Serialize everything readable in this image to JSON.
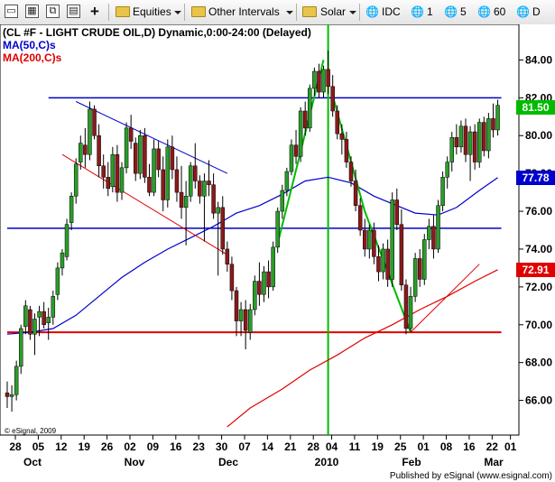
{
  "toolbar": {
    "items": [
      {
        "label": "Equities",
        "icon": "folder-icon",
        "dropdown": true
      },
      {
        "label": "Other Intervals",
        "icon": "folder-icon",
        "dropdown": true
      },
      {
        "label": "Solar",
        "icon": "folder-icon",
        "dropdown": true
      },
      {
        "label": "IDC",
        "icon": "globe-icon"
      },
      {
        "label": "1",
        "icon": "globe-icon"
      },
      {
        "label": "5",
        "icon": "globe-icon"
      },
      {
        "label": "60",
        "icon": "globe-icon"
      },
      {
        "label": "D",
        "icon": "globe-icon"
      }
    ]
  },
  "chart_data": {
    "type": "candlestick",
    "title": "(CL #F - LIGHT CRUDE OIL,D) Dynamic,0:00-24:00 (Delayed)",
    "indicators": [
      {
        "name": "MA(50,C)s",
        "color": "#0000cc",
        "last_value": "77.78"
      },
      {
        "name": "MA(200,C)s",
        "color": "#e00000",
        "last_value": "72.91"
      }
    ],
    "last_price": "81.50",
    "last_price_color": "#00bb00",
    "copyright": "© eSignal, 2009",
    "footer": "Published by eSignal (www.esignal.com)",
    "ylim": [
      64.5,
      85.5
    ],
    "y_ticks": [
      "84.00",
      "82.00",
      "80.00",
      "78.00",
      "76.00",
      "74.00",
      "72.00",
      "70.00",
      "68.00",
      "66.00"
    ],
    "x_day_labels": [
      "28",
      "05",
      "12",
      "19",
      "26",
      "02",
      "09",
      "16",
      "23",
      "30",
      "07",
      "14",
      "21",
      "28",
      "04",
      "11",
      "19",
      "25",
      "01",
      "08",
      "16",
      "22",
      "01"
    ],
    "x_month_labels": [
      "Oct",
      "Nov",
      "Dec",
      "2010",
      "Feb",
      "Mar"
    ],
    "candles": [
      [
        66.4,
        67.0,
        65.6,
        66.2
      ],
      [
        66.2,
        66.8,
        65.4,
        66.3
      ],
      [
        66.3,
        68.1,
        66.0,
        67.8
      ],
      [
        67.8,
        70.0,
        67.4,
        69.8
      ],
      [
        69.9,
        71.3,
        69.5,
        71.0
      ],
      [
        70.8,
        71.0,
        69.2,
        69.5
      ],
      [
        69.5,
        70.6,
        68.4,
        70.3
      ],
      [
        70.4,
        71.0,
        69.4,
        70.7
      ],
      [
        70.7,
        71.2,
        69.8,
        70.0
      ],
      [
        70.1,
        70.9,
        69.2,
        70.4
      ],
      [
        70.4,
        71.8,
        70.0,
        71.5
      ],
      [
        71.6,
        73.3,
        71.3,
        73.0
      ],
      [
        73.0,
        74.0,
        72.6,
        73.8
      ],
      [
        73.6,
        75.6,
        73.4,
        75.3
      ],
      [
        75.4,
        77.0,
        75.0,
        76.8
      ],
      [
        76.8,
        78.8,
        76.4,
        78.5
      ],
      [
        78.6,
        80.0,
        78.2,
        79.6
      ],
      [
        79.5,
        80.4,
        78.3,
        79.0
      ],
      [
        79.0,
        81.8,
        78.7,
        81.4
      ],
      [
        81.4,
        81.6,
        79.8,
        80.0
      ],
      [
        80.0,
        80.6,
        77.8,
        78.4
      ],
      [
        78.4,
        79.0,
        77.2,
        77.8
      ],
      [
        77.8,
        78.6,
        76.8,
        77.2
      ],
      [
        77.3,
        79.4,
        77.0,
        79.0
      ],
      [
        79.0,
        79.5,
        76.5,
        77.0
      ],
      [
        77.0,
        78.6,
        76.6,
        78.3
      ],
      [
        78.3,
        80.7,
        78.0,
        80.4
      ],
      [
        80.4,
        81.1,
        79.3,
        79.7
      ],
      [
        79.6,
        79.9,
        77.6,
        78.0
      ],
      [
        78.0,
        80.3,
        77.7,
        80.0
      ],
      [
        80.0,
        80.4,
        77.5,
        77.8
      ],
      [
        77.8,
        78.5,
        76.8,
        77.0
      ],
      [
        77.0,
        79.8,
        76.8,
        79.3
      ],
      [
        79.3,
        79.7,
        77.8,
        78.2
      ],
      [
        78.2,
        78.9,
        76.0,
        76.6
      ],
      [
        76.6,
        79.8,
        76.2,
        79.4
      ],
      [
        79.4,
        80.0,
        77.7,
        78.2
      ],
      [
        78.2,
        78.9,
        76.5,
        77.0
      ],
      [
        77.0,
        78.4,
        75.6,
        76.2
      ],
      [
        76.2,
        77.6,
        74.2,
        76.8
      ],
      [
        76.8,
        78.6,
        76.5,
        78.4
      ],
      [
        78.4,
        79.6,
        77.2,
        77.6
      ],
      [
        77.6,
        77.9,
        76.4,
        76.8
      ],
      [
        76.8,
        78.0,
        74.4,
        77.6
      ],
      [
        77.6,
        78.7,
        76.8,
        77.4
      ],
      [
        77.4,
        78.0,
        75.6,
        75.9
      ],
      [
        75.9,
        76.5,
        72.6,
        76.2
      ],
      [
        76.2,
        76.8,
        73.7,
        74.0
      ],
      [
        74.0,
        74.4,
        72.8,
        73.2
      ],
      [
        73.2,
        73.6,
        71.3,
        71.8
      ],
      [
        71.8,
        72.0,
        69.4,
        70.2
      ],
      [
        70.2,
        71.2,
        69.4,
        70.8
      ],
      [
        70.8,
        71.3,
        68.7,
        69.7
      ],
      [
        69.6,
        71.1,
        69.2,
        70.8
      ],
      [
        70.8,
        72.6,
        70.5,
        72.3
      ],
      [
        72.3,
        73.3,
        71.0,
        71.6
      ],
      [
        71.6,
        73.1,
        71.2,
        72.8
      ],
      [
        72.8,
        73.4,
        71.4,
        72.0
      ],
      [
        72.0,
        74.4,
        71.8,
        74.1
      ],
      [
        74.1,
        76.2,
        73.8,
        76.0
      ],
      [
        76.0,
        77.4,
        75.6,
        77.1
      ],
      [
        77.1,
        78.3,
        76.8,
        78.1
      ],
      [
        78.1,
        79.8,
        77.9,
        79.5
      ],
      [
        79.5,
        80.3,
        78.5,
        78.9
      ],
      [
        78.9,
        81.5,
        78.6,
        81.3
      ],
      [
        81.3,
        81.8,
        80.0,
        80.4
      ],
      [
        80.4,
        82.7,
        80.2,
        82.5
      ],
      [
        82.5,
        83.6,
        82.1,
        83.4
      ],
      [
        83.4,
        83.8,
        82.0,
        82.3
      ],
      [
        82.3,
        83.7,
        82.0,
        83.5
      ],
      [
        83.5,
        84.5,
        82.2,
        82.6
      ],
      [
        82.6,
        83.2,
        81.0,
        81.3
      ],
      [
        81.3,
        81.6,
        79.8,
        80.1
      ],
      [
        80.1,
        80.6,
        79.0,
        79.8
      ],
      [
        79.8,
        80.2,
        78.3,
        78.6
      ],
      [
        78.6,
        78.9,
        77.3,
        77.6
      ],
      [
        77.6,
        78.2,
        76.0,
        76.3
      ],
      [
        76.3,
        76.7,
        74.7,
        75.0
      ],
      [
        75.0,
        75.6,
        73.6,
        74.0
      ],
      [
        74.0,
        75.3,
        73.5,
        75.0
      ],
      [
        75.0,
        75.4,
        73.2,
        73.6
      ],
      [
        73.6,
        74.2,
        72.3,
        72.8
      ],
      [
        72.8,
        74.3,
        72.4,
        74.0
      ],
      [
        74.0,
        74.5,
        72.0,
        72.4
      ],
      [
        72.4,
        77.0,
        72.0,
        76.6
      ],
      [
        76.6,
        77.2,
        75.0,
        75.3
      ],
      [
        75.3,
        76.1,
        71.8,
        72.1
      ],
      [
        72.1,
        72.4,
        69.5,
        69.8
      ],
      [
        69.8,
        72.0,
        69.6,
        71.5
      ],
      [
        71.5,
        73.8,
        71.2,
        73.5
      ],
      [
        73.5,
        74.0,
        72.0,
        72.4
      ],
      [
        72.4,
        74.8,
        72.1,
        74.5
      ],
      [
        74.5,
        75.6,
        74.0,
        75.2
      ],
      [
        75.2,
        75.8,
        73.5,
        74.0
      ],
      [
        74.0,
        76.6,
        73.8,
        76.3
      ],
      [
        76.3,
        78.1,
        76.0,
        77.8
      ],
      [
        77.8,
        78.9,
        77.2,
        78.6
      ],
      [
        78.6,
        80.2,
        78.1,
        79.9
      ],
      [
        79.9,
        80.6,
        79.0,
        79.4
      ],
      [
        79.4,
        80.8,
        79.1,
        80.5
      ],
      [
        80.5,
        80.9,
        78.6,
        79.0
      ],
      [
        79.0,
        80.5,
        77.6,
        80.2
      ],
      [
        80.2,
        80.6,
        78.2,
        78.6
      ],
      [
        78.6,
        80.9,
        78.3,
        80.7
      ],
      [
        80.7,
        81.0,
        78.9,
        79.2
      ],
      [
        79.2,
        81.2,
        78.8,
        80.9
      ],
      [
        80.9,
        81.7,
        79.9,
        80.3
      ],
      [
        80.3,
        81.9,
        80.0,
        81.6
      ]
    ],
    "ma50": [
      [
        0,
        69.5
      ],
      [
        5,
        69.6
      ],
      [
        10,
        69.8
      ],
      [
        15,
        70.5
      ],
      [
        20,
        71.5
      ],
      [
        25,
        72.5
      ],
      [
        30,
        73.3
      ],
      [
        35,
        74.0
      ],
      [
        40,
        74.6
      ],
      [
        45,
        75.2
      ],
      [
        50,
        75.9
      ],
      [
        55,
        76.3
      ],
      [
        60,
        76.9
      ],
      [
        65,
        77.6
      ],
      [
        70,
        77.8
      ],
      [
        75,
        77.5
      ],
      [
        80,
        76.8
      ],
      [
        85,
        76.3
      ],
      [
        89,
        75.9
      ],
      [
        94,
        75.8
      ],
      [
        98,
        76.2
      ],
      [
        103,
        77.1
      ],
      [
        107,
        77.78
      ]
    ],
    "ma200": [
      [
        48,
        64.6
      ],
      [
        53,
        65.6
      ],
      [
        60,
        66.6
      ],
      [
        66,
        67.6
      ],
      [
        72,
        68.4
      ],
      [
        78,
        69.3
      ],
      [
        84,
        70.0
      ],
      [
        90,
        70.8
      ],
      [
        96,
        71.5
      ],
      [
        102,
        72.3
      ],
      [
        107,
        72.91
      ]
    ],
    "h_lines": [
      {
        "value": 82.0,
        "color": "#0000cc",
        "from": 9,
        "to": 107
      },
      {
        "value": 75.1,
        "color": "#0000cc",
        "from": 0,
        "to": 107
      },
      {
        "value": 69.6,
        "color": "#e00000",
        "from": 0,
        "to": 107
      }
    ],
    "v_line": {
      "at": 70,
      "color": "#00bb00"
    },
    "trend_lines": [
      {
        "points": [
          [
            15,
            81.8
          ],
          [
            48,
            78.0
          ]
        ],
        "color": "#0000cc"
      },
      {
        "points": [
          [
            12,
            79.0
          ],
          [
            48,
            73.7
          ]
        ],
        "color": "#e00000"
      },
      {
        "points": [
          [
            59,
            74.3
          ],
          [
            69,
            84.0
          ]
        ],
        "color": "#00bb00"
      },
      {
        "points": [
          [
            71,
            82.1
          ],
          [
            78,
            76.0
          ],
          [
            88,
            69.6
          ]
        ],
        "color": "#00bb00"
      },
      {
        "points": [
          [
            88,
            69.6
          ],
          [
            103,
            73.2
          ]
        ],
        "color": "#e00000"
      }
    ]
  }
}
